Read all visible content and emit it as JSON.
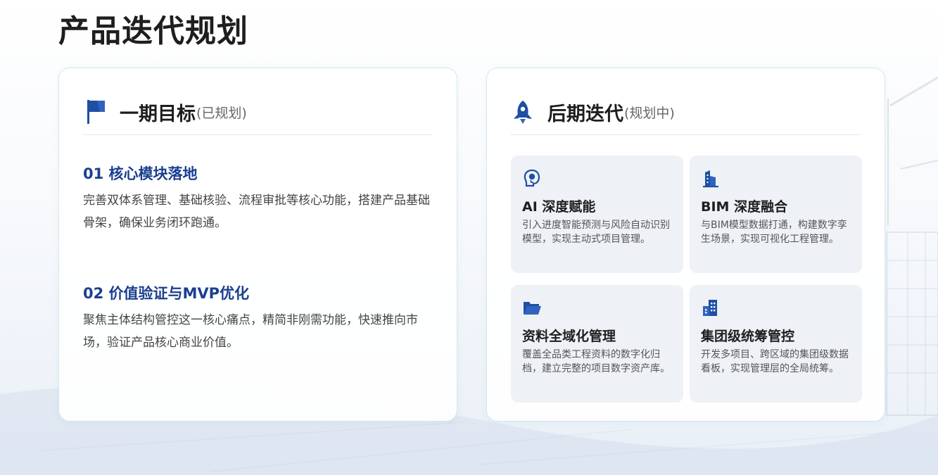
{
  "page_title": "产品迭代规划",
  "phase1": {
    "title": "一期目标",
    "status": "(已规划)",
    "icon": "flag-icon",
    "goals": [
      {
        "title": "01 核心模块落地",
        "desc": "完善双体系管理、基础核验、流程审批等核心功能，搭建产品基础骨架，确保业务闭环跑通。"
      },
      {
        "title": "02 价值验证与MVP优化",
        "desc": "聚焦主体结构管控这一核心痛点，精简非刚需功能，快速推向市场，验证产品核心商业价值。"
      }
    ]
  },
  "phase2": {
    "title": "后期迭代",
    "status": "(规划中)",
    "icon": "rocket-icon",
    "items": [
      {
        "icon": "ai-brain-icon",
        "title": "AI 深度赋能",
        "desc": "引入进度智能预测与风险自动识别模型，实现主动式项目管理。"
      },
      {
        "icon": "building-icon",
        "title": "BIM 深度融合",
        "desc": "与BIM模型数据打通，构建数字孪生场景，实现可视化工程管理。"
      },
      {
        "icon": "folder-open-icon",
        "title": "资料全域化管理",
        "desc": "覆盖全品类工程资料的数字化归档，建立完整的项目数字资产库。"
      },
      {
        "icon": "office-buildings-icon",
        "title": "集团级统筹管控",
        "desc": "开发多项目、跨区域的集团级数据看板，实现管理层的全局统筹。"
      }
    ]
  },
  "colors": {
    "accent": "#1b3f8f",
    "icon_blue": "#1e4fa3",
    "card_border": "#cfeaea",
    "tile_bg": "#eef1f5"
  }
}
